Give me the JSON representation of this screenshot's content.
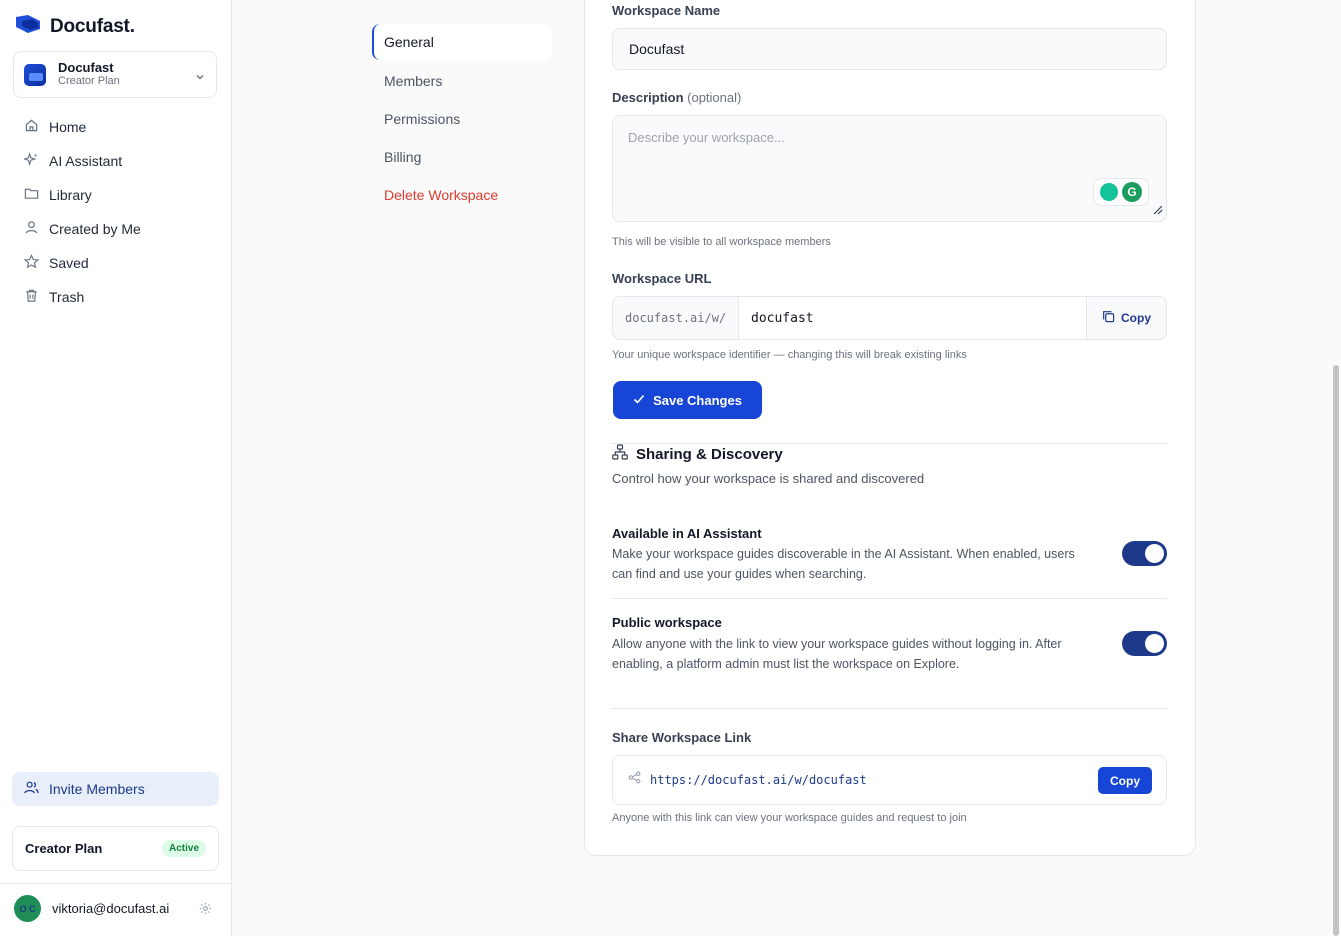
{
  "app": {
    "logo_text": "Docufast."
  },
  "workspace_switcher": {
    "name": "Docufast",
    "plan": "Creator Plan"
  },
  "sidebar": {
    "items": [
      {
        "label": "Home",
        "icon": "home-icon"
      },
      {
        "label": "AI Assistant",
        "icon": "sparkle-icon"
      },
      {
        "label": "Library",
        "icon": "folder-icon"
      },
      {
        "label": "Created by Me",
        "icon": "user-icon"
      },
      {
        "label": "Saved",
        "icon": "star-icon"
      },
      {
        "label": "Trash",
        "icon": "trash-icon"
      }
    ],
    "invite_label": "Invite Members",
    "plan_card": {
      "name": "Creator Plan",
      "status": "Active"
    },
    "user": {
      "email": "viktoria@docufast.ai",
      "avatar_text": "O C"
    }
  },
  "settings_nav": {
    "items": [
      {
        "label": "General",
        "active": true
      },
      {
        "label": "Members"
      },
      {
        "label": "Permissions"
      },
      {
        "label": "Billing"
      },
      {
        "label": "Delete Workspace",
        "danger": true
      }
    ]
  },
  "general": {
    "name_label": "Workspace Name",
    "name_value": "Docufast",
    "desc_label": "Description",
    "desc_optional": "(optional)",
    "desc_placeholder": "Describe your workspace...",
    "desc_help": "This will be visible to all workspace members",
    "url_label": "Workspace URL",
    "url_prefix": "docufast.ai/w/",
    "url_value": "docufast",
    "url_copy": "Copy",
    "url_help": "Your unique workspace identifier — changing this will break existing links",
    "save_label": "Save Changes"
  },
  "sharing": {
    "title": "Sharing & Discovery",
    "subtitle": "Control how your workspace is shared and discovered",
    "ai_title": "Available in AI Assistant",
    "ai_desc": "Make your workspace guides discoverable in the AI Assistant. When enabled, users can find and use your guides when searching.",
    "ai_enabled": true,
    "public_title": "Public workspace",
    "public_desc": "Allow anyone with the link to view your workspace guides without logging in. After enabling, a platform admin must list the workspace on Explore.",
    "public_enabled": true,
    "link_label": "Share Workspace Link",
    "link_value": "https://docufast.ai/w/docufast",
    "link_copy": "Copy",
    "link_help": "Anyone with this link can view your workspace guides and request to join"
  },
  "colors": {
    "accent": "#1746d6",
    "toggle_on": "#1d3a8a",
    "danger": "#dc3b2f",
    "active_badge": "#15803d"
  }
}
